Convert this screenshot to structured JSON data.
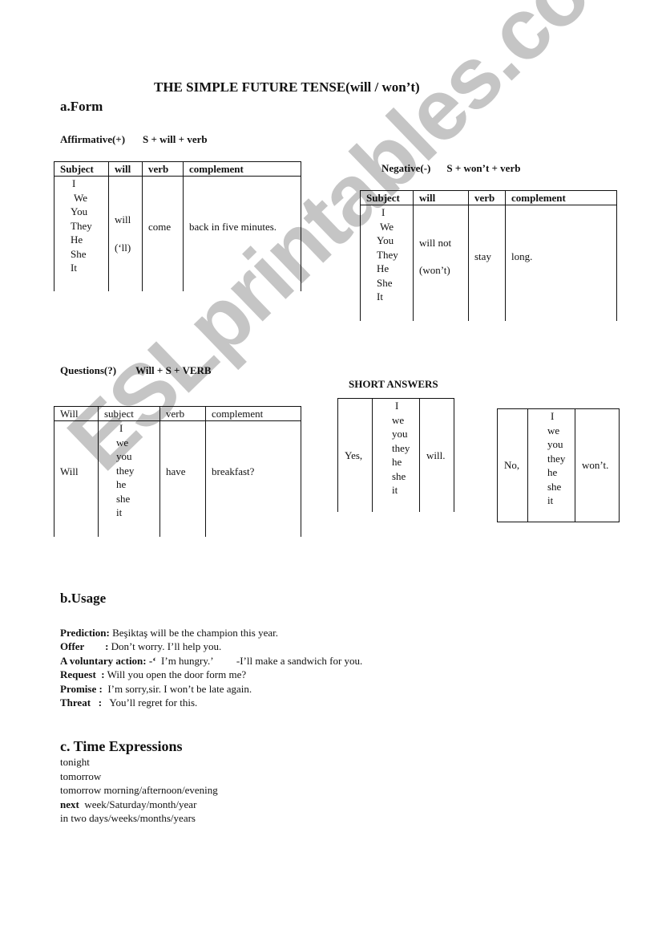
{
  "title": "THE SIMPLE FUTURE TENSE(will / won’t)",
  "watermark": "ESLprintables.com",
  "form": {
    "heading": "a.Form",
    "affirmative": {
      "label": "Affirmative(+)",
      "formula": "S + will + verb",
      "headers": [
        "Subject",
        "will",
        "verb",
        "complement"
      ],
      "subjects": [
        "I",
        "We",
        "You",
        "They",
        "He",
        "She",
        "It"
      ],
      "will": [
        "will",
        "(‘ll)"
      ],
      "verb": "come",
      "complement": "back in five minutes."
    },
    "negative": {
      "label": "Negative(-)",
      "formula": "S + won’t + verb",
      "headers": [
        "Subject",
        "will",
        "verb",
        "complement"
      ],
      "subjects": [
        "I",
        "We",
        "You",
        "They",
        "He",
        "She",
        "It"
      ],
      "will": [
        "will not",
        "(won’t)"
      ],
      "verb": "stay",
      "complement": "long."
    },
    "questions": {
      "label": "Questions(?)",
      "formula": "Will + S + VERB",
      "headers": [
        "Will",
        "subject",
        "verb",
        "complement"
      ],
      "will": "Will",
      "subjects": [
        "I",
        "we",
        "you",
        "they",
        "he",
        "she",
        "it"
      ],
      "verb": "have",
      "complement": "breakfast?"
    },
    "short_answers": {
      "heading": "SHORT ANSWERS",
      "yes": {
        "lead": "Yes,",
        "subjects": [
          "I",
          "we",
          "you",
          "they",
          "he",
          "she",
          "it"
        ],
        "tail": "will."
      },
      "no": {
        "lead": "No,",
        "subjects": [
          "I",
          "we",
          "you",
          "they",
          "he",
          "she",
          "it"
        ],
        "tail": "won’t."
      }
    }
  },
  "usage": {
    "heading": "b.Usage",
    "items": [
      {
        "label": "Prediction:",
        "text": " Beşiktaş will be the champion this year."
      },
      {
        "label": "Offer        :",
        "text": " Don’t worry. I’ll help you."
      },
      {
        "label": "A voluntary action: -‘",
        "text": "  I’m hungry.’         -I’ll make a sandwich for you."
      },
      {
        "label": "Request  :",
        "text": " Will you open the door form me?"
      },
      {
        "label": "Promise :",
        "text": "  I’m sorry,sir. I won’t be late again."
      },
      {
        "label": "Threat   :",
        "text": "   You’ll regret for this."
      }
    ]
  },
  "time_expressions": {
    "heading": "c. Time Expressions",
    "items": [
      {
        "bold": "",
        "text": "tonight"
      },
      {
        "bold": "",
        "text": "tomorrow"
      },
      {
        "bold": "",
        "text": "tomorrow morning/afternoon/evening"
      },
      {
        "bold": "next",
        "text": "  week/Saturday/month/year"
      },
      {
        "bold": "",
        "text": "in two days/weeks/months/years"
      }
    ]
  }
}
